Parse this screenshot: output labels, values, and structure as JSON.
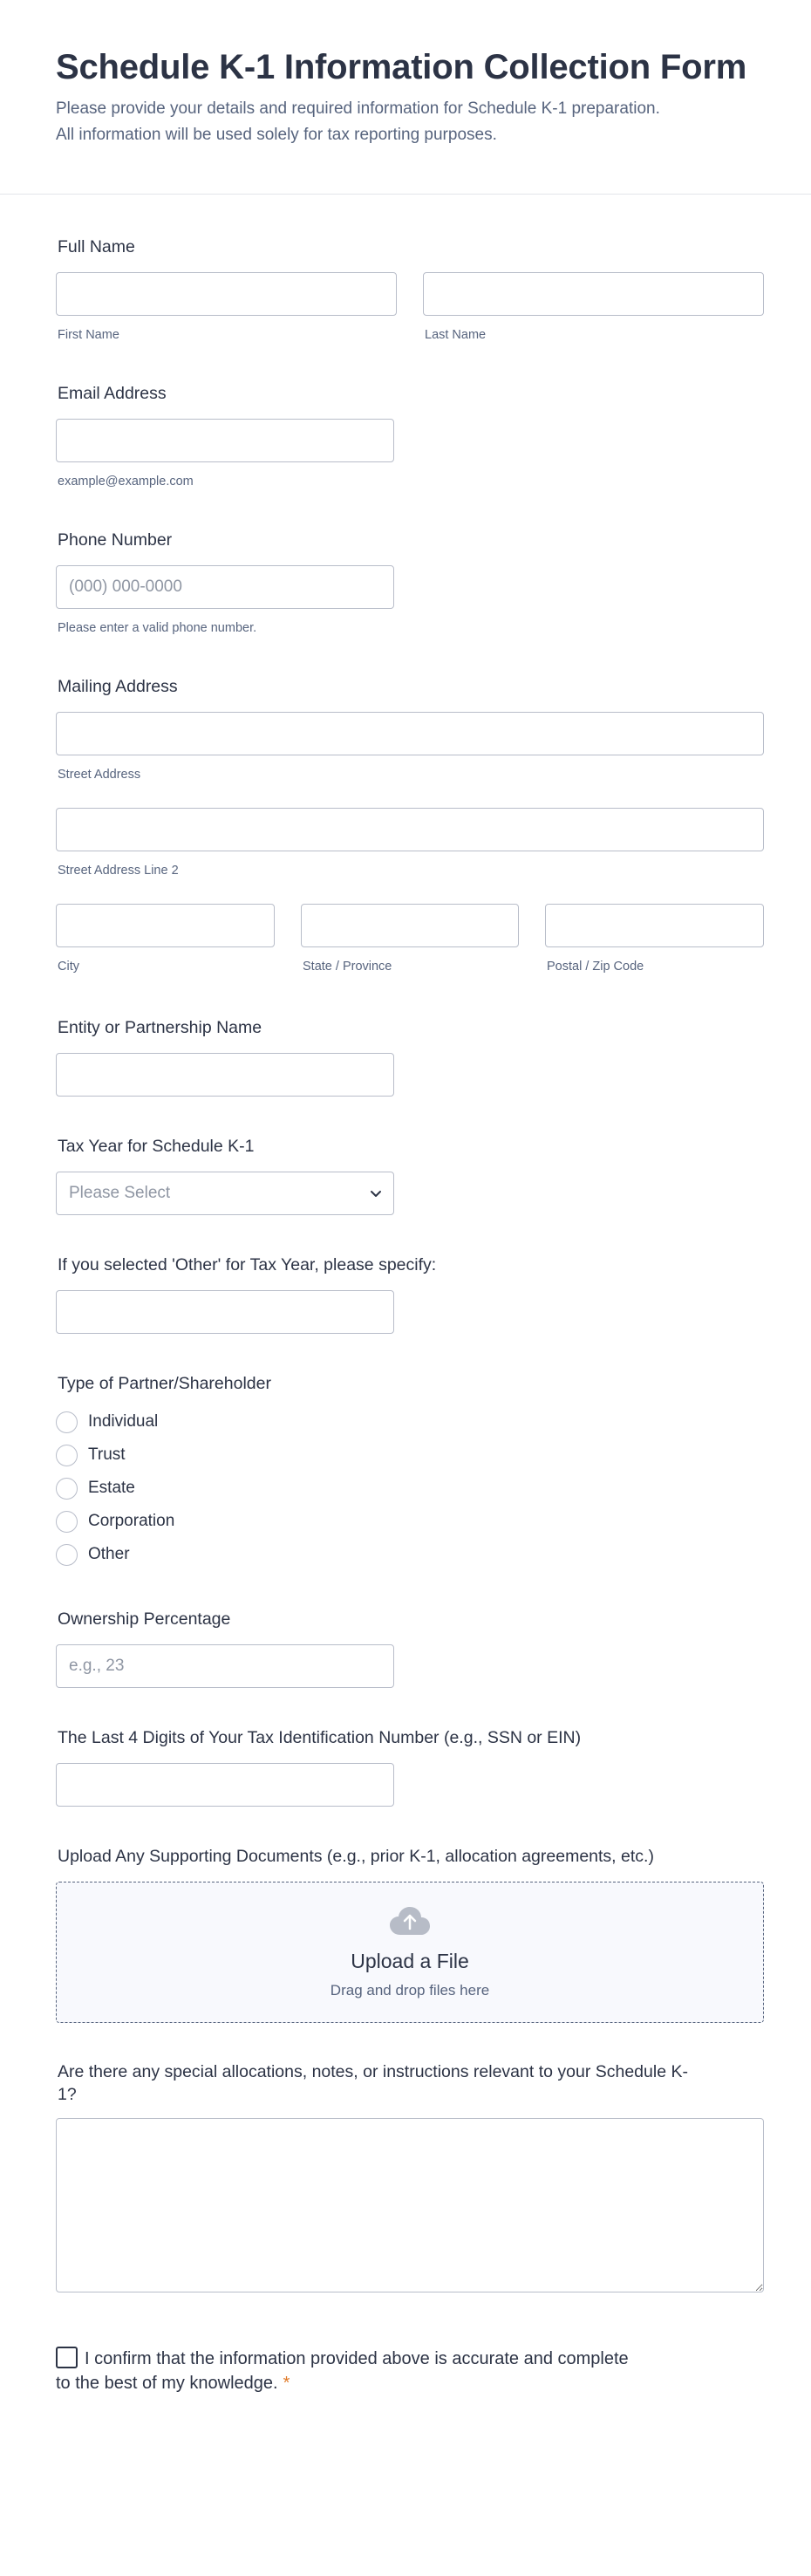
{
  "header": {
    "title": "Schedule K-1 Information Collection Form",
    "subtitle_line1": "Please provide your details and required information for Schedule K-1 preparation.",
    "subtitle_line2": "All information will be used solely for tax reporting purposes."
  },
  "full_name": {
    "label": "Full Name",
    "first_sublabel": "First Name",
    "last_sublabel": "Last Name",
    "first_value": "",
    "last_value": ""
  },
  "email": {
    "label": "Email Address",
    "sublabel": "example@example.com",
    "value": ""
  },
  "phone": {
    "label": "Phone Number",
    "placeholder": "(000) 000-0000",
    "sublabel": "Please enter a valid phone number."
  },
  "address": {
    "label": "Mailing Address",
    "street_sublabel": "Street Address",
    "street2_sublabel": "Street Address Line 2",
    "city_sublabel": "City",
    "state_sublabel": "State / Province",
    "zip_sublabel": "Postal / Zip Code"
  },
  "entity": {
    "label": "Entity or Partnership Name"
  },
  "tax_year": {
    "label": "Tax Year for Schedule K-1",
    "selected": "Please Select"
  },
  "tax_year_other": {
    "label": "If you selected 'Other' for Tax Year, please specify:"
  },
  "partner_type": {
    "label": "Type of Partner/Shareholder",
    "options": [
      "Individual",
      "Trust",
      "Estate",
      "Corporation",
      "Other"
    ]
  },
  "ownership": {
    "label": "Ownership Percentage",
    "placeholder": "e.g., 23"
  },
  "tin": {
    "label": "The Last 4 Digits of Your Tax Identification Number (e.g., SSN or EIN)"
  },
  "upload": {
    "label": "Upload Any Supporting Documents (e.g., prior K-1, allocation agreements, etc.)",
    "title": "Upload a File",
    "subtitle": "Drag and drop files here"
  },
  "notes": {
    "label_line1": "Are there any special allocations, notes, or instructions relevant to your Schedule K-",
    "label_line2": "1?"
  },
  "confirm": {
    "text_line1": "I confirm that the information provided above is accurate and complete",
    "text_line2": "to the best of my knowledge.",
    "required_mark": "*"
  }
}
